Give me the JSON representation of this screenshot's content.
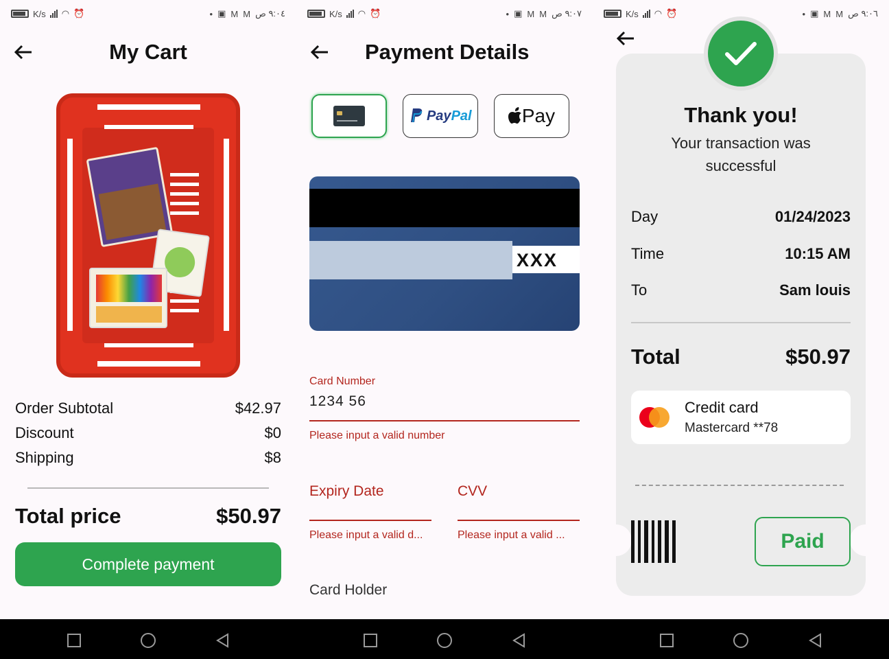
{
  "status_bars": [
    {
      "left": "K/s",
      "time": "٩:٠٤ ص"
    },
    {
      "left": "K/s",
      "time": "٩:٠٧ ص"
    },
    {
      "left": "K/s",
      "time": "٩:٠٦ ص"
    }
  ],
  "cart": {
    "title": "My Cart",
    "rows": [
      {
        "label": "Order Subtotal",
        "value": "$42.97"
      },
      {
        "label": "Discount",
        "value": "$0"
      },
      {
        "label": "Shipping",
        "value": "$8"
      }
    ],
    "total_label": "Total price",
    "total_value": "$50.97",
    "button_label": "Complete payment",
    "colors": {
      "accent": "#2ea44f",
      "basket": "#e0321f"
    }
  },
  "payment": {
    "title": "Payment Details",
    "options": [
      {
        "name": "card-icon",
        "label": ""
      },
      {
        "name": "paypal",
        "label_a": "Pay",
        "label_b": "Pal"
      },
      {
        "name": "apple-pay",
        "label": "Pay"
      }
    ],
    "card_cvv_display": "XXX",
    "card_number": {
      "label": "Card Number",
      "value": "1234 56",
      "error": "Please input a valid number"
    },
    "expiry": {
      "label": "Expiry Date",
      "error": "Please input a valid d..."
    },
    "cvv": {
      "label": "CVV",
      "error": "Please input a valid ..."
    },
    "holder_label": "Card Holder",
    "error_color": "#b3261e"
  },
  "receipt": {
    "title": "Thank you!",
    "subtitle": "Your transaction was successful",
    "details": [
      {
        "label": "Day",
        "value": "01/24/2023"
      },
      {
        "label": "Time",
        "value": "10:15 AM"
      },
      {
        "label": "To",
        "value": "Sam louis"
      }
    ],
    "total_label": "Total",
    "total_value": "$50.97",
    "method_title": "Credit card",
    "method_sub": "Mastercard **78",
    "paid_label": "Paid"
  }
}
